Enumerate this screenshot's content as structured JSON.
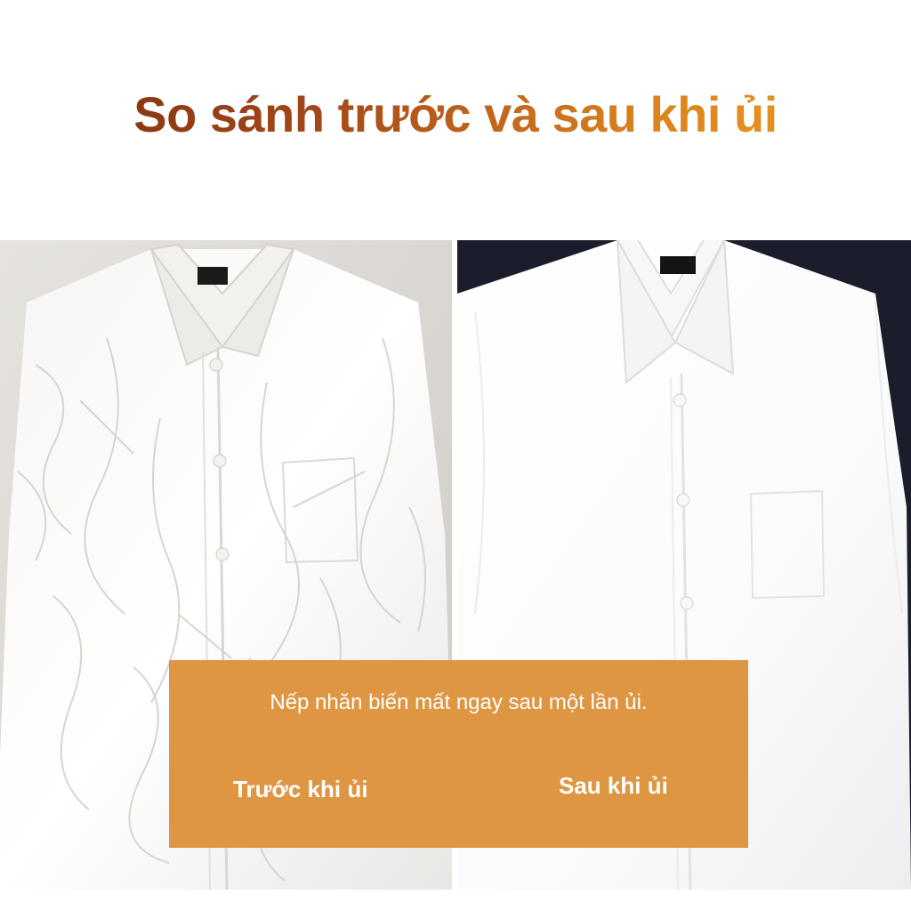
{
  "title": "So sánh trước và sau khi ủi",
  "caption": {
    "text": "Nếp nhăn biến mất ngay sau một lần ủi.",
    "before_label": "Trước khi ủi",
    "after_label": "Sau khi ủi"
  },
  "colors": {
    "title_gradient": [
      "#7a2e0e",
      "#a4481a",
      "#d9801e",
      "#f0a322"
    ],
    "caption_bg": "#de9643",
    "after_bg": "#1b1d2c"
  },
  "images": {
    "before": "wrinkled white shirt",
    "after": "ironed white shirt"
  }
}
